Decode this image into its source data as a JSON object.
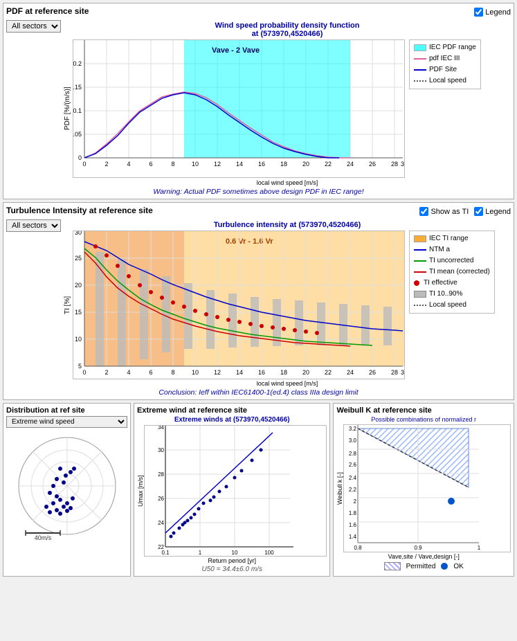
{
  "pdf_panel": {
    "title": "PDF at reference site",
    "sector_label": "All sectors",
    "chart_title": "Wind speed probability density function",
    "chart_subtitle": "at (573970,4520466)",
    "vave_label": "Vave - 2 Vave",
    "warning": "Warning: Actual PDF sometimes above design PDF in IEC range!",
    "x_axis": "local wind speed [m/s]",
    "y_axis": "PDF [%/(m/s)]",
    "legend_title": "Legend",
    "legend_items": [
      {
        "label": "IEC PDF range",
        "type": "cyan"
      },
      {
        "label": "pdf IEC III",
        "type": "pink"
      },
      {
        "label": "PDF Site",
        "type": "blue"
      },
      {
        "label": "Local speed",
        "type": "dotted"
      }
    ]
  },
  "ti_panel": {
    "title": "Turbulence Intensity at reference site",
    "sector_label": "All sectors",
    "chart_title": "Turbulence intensity at (573970,4520466)",
    "vr_label": "0.6 Vr - 1.6 Vr",
    "conclusion": "Conclusion: Ieff within IEC61400-1(ed.4) class IIIa design limit",
    "x_axis": "local wind speed [m/s]",
    "y_axis": "TI [%]",
    "show_as_ti": "Show as TI",
    "legend_title": "Legend",
    "legend_items": [
      {
        "label": "IEC TI range",
        "type": "orange"
      },
      {
        "label": "NTM a",
        "type": "blue"
      },
      {
        "label": "TI uncorrected",
        "type": "green"
      },
      {
        "label": "TI mean (corrected)",
        "type": "red"
      },
      {
        "label": "TI effective",
        "type": "red-dot"
      },
      {
        "label": "TI 10..90%",
        "type": "gray"
      },
      {
        "label": "Local speed",
        "type": "dotted"
      }
    ]
  },
  "distribution_panel": {
    "title": "Distribution at ref site",
    "dropdown": "Extreme wind speed",
    "scale_label": "40m/s"
  },
  "extreme_wind_panel": {
    "title": "Extreme wind at reference site",
    "chart_title": "Extreme winds at (573970,4520466)",
    "x_axis": "Return period [yr]",
    "y_axis": "Umax [m/s]",
    "y_min": 22,
    "y_max": 34,
    "formula": "U50 = 34.4±6.0 m/s"
  },
  "weibull_panel": {
    "title": "Weibull K at reference site",
    "chart_title": "Possible combinations of normalized r",
    "x_axis": "Vave,site / Vave,design [-]",
    "y_axis": "Weibull k [-]",
    "x_min": 0.8,
    "x_max": 1.0,
    "y_min": 1.4,
    "y_max": 3.2,
    "permitted_label": "Permitted",
    "ok_label": "OK"
  }
}
